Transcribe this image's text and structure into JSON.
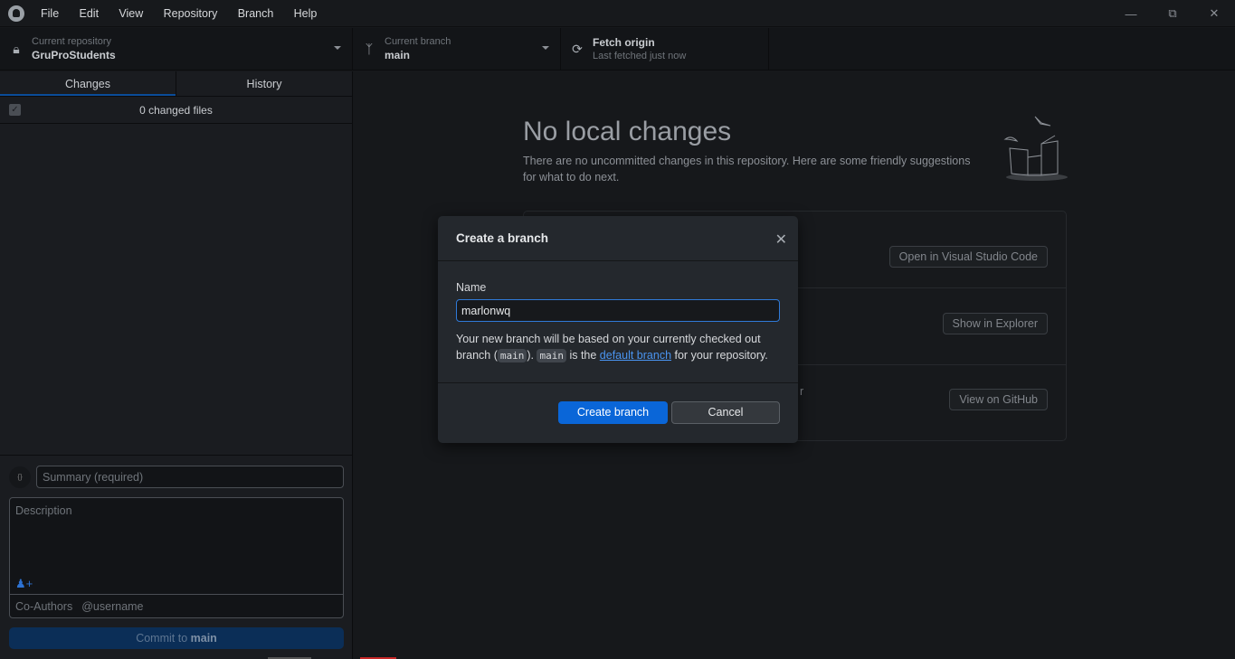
{
  "menu": [
    "File",
    "Edit",
    "View",
    "Repository",
    "Branch",
    "Help"
  ],
  "toolbar": {
    "repo": {
      "label": "Current repository",
      "value": "GruProStudents"
    },
    "branch": {
      "label": "Current branch",
      "value": "main"
    },
    "fetch": {
      "label": "Fetch origin",
      "sub": "Last fetched just now"
    }
  },
  "sidebar": {
    "tabs": [
      "Changes",
      "History"
    ],
    "active_tab": "Changes",
    "changed_files": "0 changed files",
    "summary_placeholder": "Summary (required)",
    "description_placeholder": "Description",
    "coauthors_label": "Co-Authors",
    "coauthors_placeholder": "@username",
    "commit_prefix": "Commit to ",
    "commit_branch": "main"
  },
  "main": {
    "title": "No local changes",
    "lead": "There are no uncommitted changes in this repository. Here are some friendly suggestions for what to do next.",
    "partial_text": "r",
    "buttons": [
      "Open in Visual Studio Code",
      "Show in Explorer",
      "View on GitHub"
    ]
  },
  "dialog": {
    "title": "Create a branch",
    "name_label": "Name",
    "name_value": "marlonwq",
    "help_1": "Your new branch will be based on your currently checked out branch (",
    "code_1": "main",
    "help_2": "). ",
    "code_2": "main",
    "help_3": " is the ",
    "link": "default branch",
    "help_4": " for your repository.",
    "primary": "Create branch",
    "secondary": "Cancel"
  },
  "colors": {
    "accent": "#0a66d8",
    "link": "#4a94f0"
  }
}
